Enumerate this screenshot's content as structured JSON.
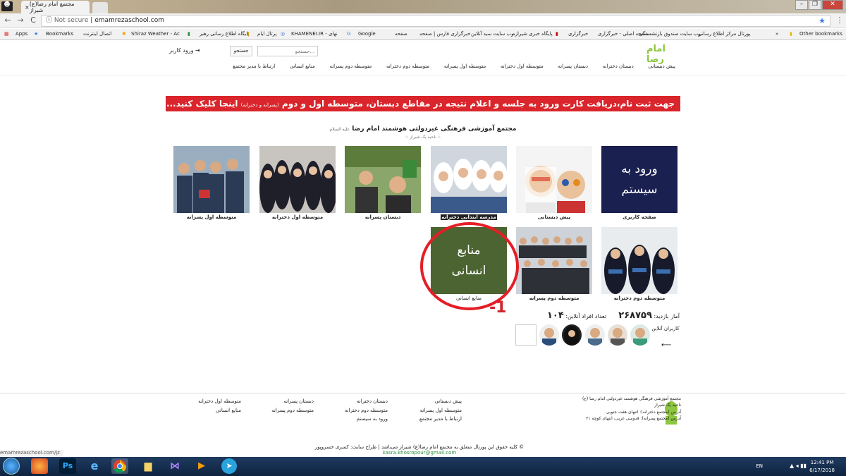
{
  "browser": {
    "tab_title": "مجتمع امام رضا(ع) شیراز",
    "tab_close": "×",
    "address_prefix": "Not secure",
    "address_url": "emamrezaschool.com",
    "win_min": "–",
    "win_max": "❐",
    "win_close": "✕",
    "avatar": "☻",
    "back": "←",
    "forward": "→",
    "reload": "C",
    "star": "★",
    "menu": "⋮",
    "bookmarks": [
      {
        "label": "Apps"
      },
      {
        "label": "Bookmarks"
      },
      {
        "label": "اتصال اینترنت"
      },
      {
        "label": "Shiraz Weather - Ac"
      },
      {
        "label": "پایگاه اطلاع رسانی رهبر"
      },
      {
        "label": "پرتال ایام"
      },
      {
        "label": "KHAMENEI.IR - نهای"
      },
      {
        "label": "Google"
      },
      {
        "label": "صفحه"
      },
      {
        "label": "خبرگزاری فارس | صفحه"
      },
      {
        "label": "وب سایت سید آنلاین"
      },
      {
        "label": "پایگاه خبری شیرازه"
      },
      {
        "label": "خبرگزاری"
      },
      {
        "label": "صفحه اصلی - خبرگزاری"
      },
      {
        "label": "وب سایت صندوق بازنشستگی"
      },
      {
        "label": "پورتال مرکز اطلاع رسانی"
      },
      {
        "label": "»"
      },
      {
        "label": "Other bookmarks"
      }
    ],
    "status_url": "emamrezaschool.com/jz"
  },
  "header": {
    "logo": "امام رضا",
    "login": "ورود کاربر",
    "search_button": "جستجو",
    "search_placeholder": "جستجو...",
    "nav": [
      "پیش دبستانی",
      "دبستان دخترانه",
      "دبستان پسرانه",
      "متوسطه اول دخترانه",
      "متوسطه اول پسرانه",
      "متوسطه دوم دخترانه",
      "متوسطه دوم پسرانه",
      "منابع انسانی",
      "ارتباط با مدیر مجتمع"
    ]
  },
  "banner": {
    "text_before": "جهت ثبت نام،دریافت کارت ورود به جلسه و اعلام نتیجه در مقاطع دبستان، متوسطه اول و دوم ",
    "small": "(پسرانه و دخترانه)",
    "text_after": " اینجا کلیک کنید..."
  },
  "org": {
    "title": "مجتمع آموزشی فرهنگی غیردولتی هوشمند امام رضا",
    "honorific": "علیه السلام",
    "region": ":: ناحیه یک شیراز ::"
  },
  "tiles_row1": [
    {
      "caption": "صفحه کاربری",
      "line1": "ورود به",
      "line2": "سیستم"
    },
    {
      "caption": "پیش دبستانی"
    },
    {
      "caption": "مدرسه ابتدایی دخترانه"
    },
    {
      "caption": "دبستان پسرانه"
    },
    {
      "caption": "متوسطه اول دخترانه"
    },
    {
      "caption": "متوسطه اول پسرانه"
    }
  ],
  "tiles_row2": [
    {
      "caption": "متوسطه دوم دخترانه"
    },
    {
      "caption": "متوسطه دوم پسرانه"
    },
    {
      "caption": "منابع انسانی",
      "line1": "منابع",
      "line2": "انسانی"
    }
  ],
  "annotation": {
    "mark": "-1"
  },
  "stats": {
    "visits_label": "آمار بازدید:",
    "visits_value": "۲۶۸۷۵۹",
    "online_label": "تعداد افراد آنلاین:",
    "online_value": "۱۰۴",
    "online_users_label": "کاربران آنلاین",
    "arrow": "⟵"
  },
  "footer": {
    "info": [
      "مجتمع آموزشی فرهنگی هوشمند غیردولتی امام رضا (ع)",
      "ناحیه یک شیراز",
      "آدرس (مجتمع دخترانه): انتهای هفت جنوبی",
      "آدرس (مجتمع پسرانه): قدوسی غربی، انتهای کوچه ۲۱"
    ],
    "col1": [
      "پیش دبستانی",
      "متوسطه اول پسرانه",
      "ارتباط با مدیر مجتمع"
    ],
    "col2": [
      "دبستان دخترانه",
      "متوسطه دوم دخترانه",
      "ورود به سیستم"
    ],
    "col3": [
      "دبستان پسرانه",
      "متوسطه دوم پسرانه"
    ],
    "col4": [
      "متوسطه اول دخترانه",
      "منابع انسانی"
    ],
    "copyright": "© کلیه حقوق این پورتال متعلق به مجتمع امام رضا(ع) شیراز می‌باشد | طراح سایت: کسری خسروپور",
    "email": "kasra.khosropour@gmail.com"
  },
  "taskbar": {
    "lang": "EN",
    "time": "12:41 PM",
    "date": "6/17/2018",
    "tray": "▲ ◂ ▮▮"
  }
}
